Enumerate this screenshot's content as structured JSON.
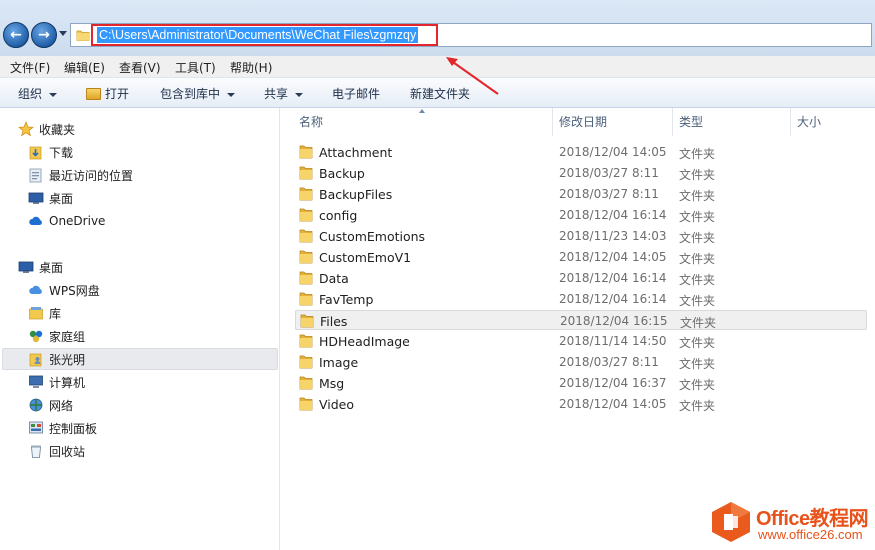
{
  "address": {
    "path": "C:\\Users\\Administrator\\Documents\\WeChat Files\\zgmzqy"
  },
  "menu": [
    "文件(F)",
    "编辑(E)",
    "查看(V)",
    "工具(T)",
    "帮助(H)"
  ],
  "toolbar": {
    "organize": "组织",
    "open": "打开",
    "include_in_library": "包含到库中",
    "share": "共享",
    "email": "电子邮件",
    "new_folder": "新建文件夹"
  },
  "nav": {
    "favorites": {
      "header": "收藏夹",
      "items": [
        "下载",
        "最近访问的位置",
        "桌面",
        "OneDrive"
      ]
    },
    "desktop": {
      "header": "桌面",
      "items": [
        "WPS网盘",
        "库",
        "家庭组",
        "张光明",
        "计算机",
        "网络",
        "控制面板",
        "回收站"
      ],
      "selected": "张光明"
    }
  },
  "columns": {
    "name": "名称",
    "date": "修改日期",
    "type": "类型",
    "size": "大小"
  },
  "files": [
    {
      "name": "Attachment",
      "date": "2018/12/04 14:05",
      "type": "文件夹"
    },
    {
      "name": "Backup",
      "date": "2018/03/27 8:11",
      "type": "文件夹"
    },
    {
      "name": "BackupFiles",
      "date": "2018/03/27 8:11",
      "type": "文件夹"
    },
    {
      "name": "config",
      "date": "2018/12/04 16:14",
      "type": "文件夹"
    },
    {
      "name": "CustomEmotions",
      "date": "2018/11/23 14:03",
      "type": "文件夹"
    },
    {
      "name": "CustomEmoV1",
      "date": "2018/12/04 14:05",
      "type": "文件夹"
    },
    {
      "name": "Data",
      "date": "2018/12/04 16:14",
      "type": "文件夹"
    },
    {
      "name": "FavTemp",
      "date": "2018/12/04 16:14",
      "type": "文件夹"
    },
    {
      "name": "Files",
      "date": "2018/12/04 16:15",
      "type": "文件夹"
    },
    {
      "name": "HDHeadImage",
      "date": "2018/11/14 14:50",
      "type": "文件夹"
    },
    {
      "name": "Image",
      "date": "2018/03/27 8:11",
      "type": "文件夹"
    },
    {
      "name": "Msg",
      "date": "2018/12/04 16:37",
      "type": "文件夹"
    },
    {
      "name": "Video",
      "date": "2018/12/04 14:05",
      "type": "文件夹"
    }
  ],
  "selected_file": "Files",
  "watermark": {
    "title": "Office教程网",
    "url": "www.office26.com"
  },
  "colors": {
    "annotation_red": "#e3262c",
    "selection_blue": "#3399ff",
    "folder_yellow": "#f2c94c",
    "watermark_orange": "#e8531b"
  }
}
